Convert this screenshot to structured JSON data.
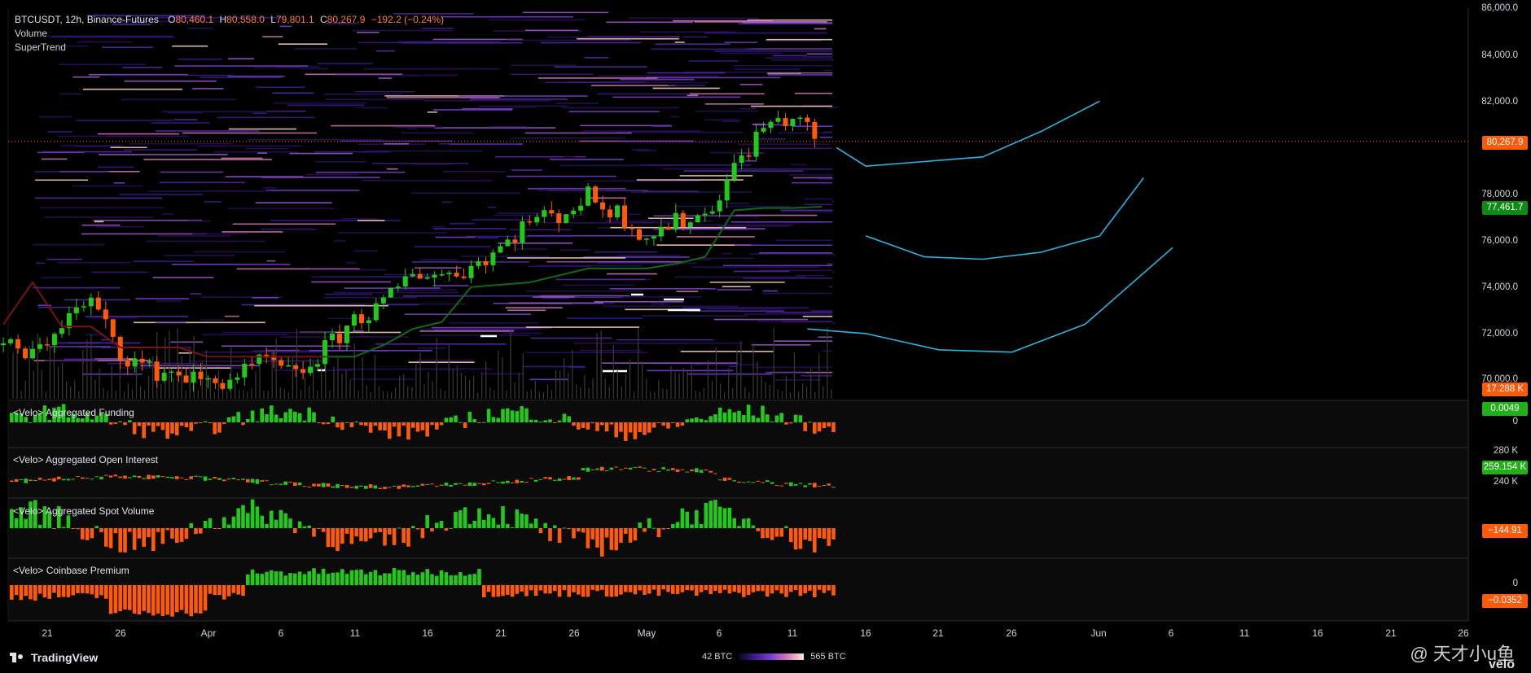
{
  "header": {
    "symbol": "BTCUSDT, 12h, Binance-Futures",
    "o_label": "O",
    "o_value": "80,460.1",
    "h_label": "H",
    "h_value": "80,558.0",
    "l_label": "L",
    "l_value": "79,801.1",
    "c_label": "C",
    "c_value": "80,267.9",
    "change": "−192.2 (−0.24%)",
    "indicator1": "Volume",
    "indicator2": "SuperTrend"
  },
  "panes": {
    "funding_title": "<Velo> Aggregated Funding",
    "oi_title": "<Velo> Aggregated Open Interest",
    "spot_title": "<Velo> Aggregated Spot Volume",
    "premium_title": "<Velo> Coinbase Premium"
  },
  "price_axis": [
    "86,000.0",
    "84,000.0",
    "82,000.0",
    "78,000.0",
    "76,000.0",
    "74,000.0",
    "72,000.0",
    "70,000.0"
  ],
  "price_tags": {
    "last_price": "80,267.9",
    "supertrend": "77,461.7",
    "volume": "17.288 K",
    "funding": "0.0049",
    "funding_zero": "0",
    "oi_top": "280 K",
    "oi": "259.154 K",
    "oi_bottom": "240 K",
    "spot": "−144.91",
    "premium_zero": "0",
    "premium": "−0.0352"
  },
  "x_axis": [
    "21",
    "26",
    "Apr",
    "6",
    "11",
    "16",
    "21",
    "26",
    "May",
    "6",
    "11",
    "16",
    "21",
    "26",
    "Jun",
    "6",
    "11",
    "16",
    "21",
    "26"
  ],
  "footer": {
    "brand": "TradingView",
    "legend_min": "42 BTC",
    "legend_max": "565 BTC",
    "watermark": "@ 天才小u鱼",
    "velo": "velo"
  },
  "colors": {
    "up": "#22c81a",
    "down": "#ff5a0a",
    "supertrend_up": "#0f6a14",
    "supertrend_down": "#7a1212",
    "projection": "#2ab4e0",
    "last_price_tag": "#ff5a0a",
    "supertrend_tag": "#0f8a14"
  },
  "chart_data": {
    "type": "candlestick",
    "title": "BTCUSDT, 12h, Binance-Futures",
    "ylim": [
      69500,
      86200
    ],
    "x": [
      "2025-03-18",
      "2025-03-20",
      "2025-03-22",
      "2025-03-24",
      "2025-03-26",
      "2025-03-28",
      "2025-03-30",
      "2025-04-01",
      "2025-04-03",
      "2025-04-05",
      "2025-04-07",
      "2025-04-09",
      "2025-04-11",
      "2025-04-13",
      "2025-04-15",
      "2025-04-17",
      "2025-04-19",
      "2025-04-21",
      "2025-04-23",
      "2025-04-25",
      "2025-04-27",
      "2025-04-29",
      "2025-05-01",
      "2025-05-03",
      "2025-05-05",
      "2025-05-07",
      "2025-05-09",
      "2025-05-11",
      "2025-05-13"
    ],
    "close": [
      71500,
      71000,
      72500,
      73400,
      71200,
      70400,
      70300,
      69800,
      70200,
      70800,
      70100,
      71300,
      72600,
      73200,
      74700,
      74500,
      74900,
      75700,
      76900,
      77100,
      77900,
      77200,
      76200,
      76800,
      77100,
      79100,
      80900,
      81300,
      80268
    ],
    "supertrend": [
      72400,
      74200,
      72300,
      72300,
      71400,
      71400,
      71400,
      71000,
      71000,
      71000,
      71000,
      71000,
      71000,
      71500,
      72200,
      72500,
      74000,
      74100,
      74200,
      74500,
      74800,
      74800,
      74800,
      75000,
      75300,
      77300,
      77400,
      77400,
      77462
    ],
    "projections": [
      {
        "x": [
          "2025-05-14",
          "2025-05-16",
          "2025-05-20",
          "2025-05-24",
          "2025-05-28",
          "2025-06-01"
        ],
        "y": [
          80000,
          79200,
          79400,
          79600,
          80700,
          82000
        ]
      },
      {
        "x": [
          "2025-05-16",
          "2025-05-20",
          "2025-05-24",
          "2025-05-28",
          "2025-06-01",
          "2025-06-04"
        ],
        "y": [
          76200,
          75300,
          75200,
          75500,
          76200,
          78700
        ]
      },
      {
        "x": [
          "2025-05-12",
          "2025-05-16",
          "2025-05-21",
          "2025-05-26",
          "2025-05-31",
          "2025-06-06"
        ],
        "y": [
          72200,
          72000,
          71300,
          71200,
          72400,
          75700
        ]
      }
    ],
    "volume_last": 17288,
    "funding_last": 0.0049,
    "open_interest_last": 259154,
    "spot_volume_last": -144.91,
    "coinbase_premium_last": -0.0352
  }
}
